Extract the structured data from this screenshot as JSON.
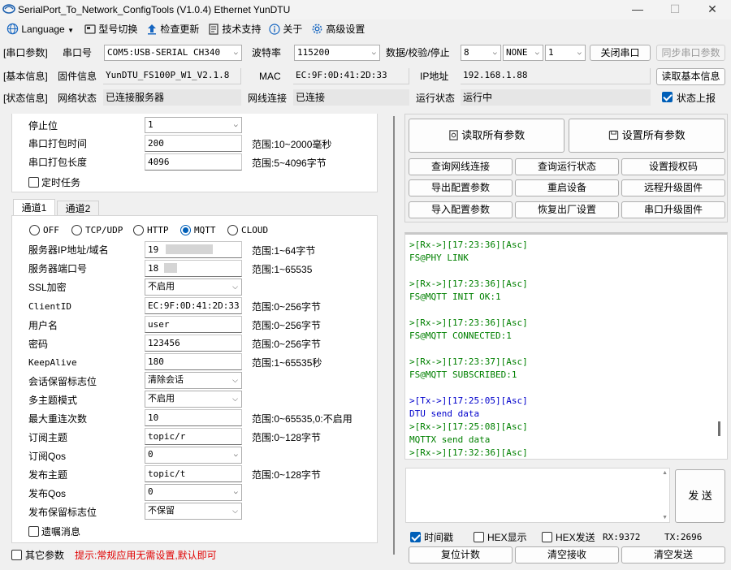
{
  "window": {
    "title": "SerialPort_To_Network_ConfigTools (V1.0.4) Ethernet YunDTU",
    "min": "—",
    "max": "☐",
    "close": "✕"
  },
  "menu": {
    "language": "Language",
    "model_switch": "型号切换",
    "check_update": "检查更新",
    "tech_support": "技术支持",
    "about": "关于",
    "advanced": "高级设置"
  },
  "serial_row": {
    "group": "[串口参数]",
    "port_label": "串口号",
    "port_value": "COM5:USB-SERIAL CH340",
    "baud_label": "波特率",
    "baud_value": "115200",
    "data_label": "数据/校验/停止",
    "data_bits": "8",
    "parity": "NONE",
    "stop_bits": "1",
    "close_port": "关闭串口",
    "sync_params": "同步串口参数"
  },
  "basic_row": {
    "group": "[基本信息]",
    "fw_label": "固件信息",
    "fw_value": "YunDTU_FS100P_W1_V2.1.8",
    "mac_label": "MAC",
    "mac_value": "EC:9F:0D:41:2D:33",
    "ip_label": "IP地址",
    "ip_value": "192.168.1.88",
    "read_basic": "读取基本信息"
  },
  "status_row": {
    "group": "[状态信息]",
    "net_label": "网络状态",
    "net_value": "已连接服务器",
    "link_label": "网线连接",
    "link_value": "已连接",
    "run_label": "运行状态",
    "run_value": "运行中",
    "report_label": "状态上报"
  },
  "serial_panel": {
    "stop_label": "停止位",
    "stop_value": "1",
    "pack_time_label": "串口打包时间",
    "pack_time_value": "200",
    "pack_time_range": "范围:10~2000毫秒",
    "pack_len_label": "串口打包长度",
    "pack_len_value": "4096",
    "pack_len_range": "范围:5~4096字节",
    "timer_task": "定时任务"
  },
  "tabs": [
    "通道1",
    "通道2"
  ],
  "protocols": [
    "OFF",
    "TCP/UDP",
    "HTTP",
    "MQTT",
    "CLOUD"
  ],
  "mqtt": {
    "server_label": "服务器IP地址/域名",
    "server_value": "19",
    "server_range": "范围:1~64字节",
    "port_label": "服务器端口号",
    "port_value": "18",
    "port_range": "范围:1~65535",
    "ssl_label": "SSL加密",
    "ssl_value": "不启用",
    "client_label": "ClientID",
    "client_value": "EC:9F:0D:41:2D:33",
    "client_range": "范围:0~256字节",
    "user_label": "用户名",
    "user_value": "user",
    "user_range": "范围:0~256字节",
    "pass_label": "密码",
    "pass_value": "123456",
    "pass_range": "范围:0~256字节",
    "keepalive_label": "KeepAlive",
    "keepalive_value": "180",
    "keepalive_range": "范围:1~65535秒",
    "clean_label": "会话保留标志位",
    "clean_value": "清除会话",
    "multi_label": "多主题模式",
    "multi_value": "不启用",
    "retry_label": "最大重连次数",
    "retry_value": "10",
    "retry_range": "范围:0~65535,0:不启用",
    "sub_topic_label": "订阅主题",
    "sub_topic_value": "topic/r",
    "sub_topic_range": "范围:0~128字节",
    "sub_qos_label": "订阅Qos",
    "sub_qos_value": "0",
    "pub_topic_label": "发布主题",
    "pub_topic_value": "topic/t",
    "pub_topic_range": "范围:0~128字节",
    "pub_qos_label": "发布Qos",
    "pub_qos_value": "0",
    "retain_label": "发布保留标志位",
    "retain_value": "不保留",
    "will_label": "遗嘱消息"
  },
  "bottom_left": {
    "other_params": "其它参数",
    "hint": "提示:常规应用无需设置,默认即可"
  },
  "right_buttons": {
    "read_all": "读取所有参数",
    "set_all": "设置所有参数",
    "query_link": "查询网线连接",
    "query_run": "查询运行状态",
    "set_auth": "设置授权码",
    "export_cfg": "导出配置参数",
    "restart": "重启设备",
    "remote_upgrade": "远程升级固件",
    "import_cfg": "导入配置参数",
    "factory_reset": "恢复出厂设置",
    "serial_upgrade": "串口升级固件"
  },
  "log": [
    {
      "cls": "rx",
      "text": ">[Rx->][17:23:36][Asc]"
    },
    {
      "cls": "rx",
      "text": "FS@PHY LINK"
    },
    {
      "cls": "",
      "text": ""
    },
    {
      "cls": "rx",
      "text": ">[Rx->][17:23:36][Asc]"
    },
    {
      "cls": "rx",
      "text": "FS@MQTT INIT OK:1"
    },
    {
      "cls": "",
      "text": ""
    },
    {
      "cls": "rx",
      "text": ">[Rx->][17:23:36][Asc]"
    },
    {
      "cls": "rx",
      "text": "FS@MQTT CONNECTED:1"
    },
    {
      "cls": "",
      "text": ""
    },
    {
      "cls": "rx",
      "text": ">[Rx->][17:23:37][Asc]"
    },
    {
      "cls": "rx",
      "text": "FS@MQTT SUBSCRIBED:1"
    },
    {
      "cls": "",
      "text": ""
    },
    {
      "cls": "tx",
      "text": ">[Tx->][17:25:05][Asc]"
    },
    {
      "cls": "tx",
      "text": "DTU send data"
    },
    {
      "cls": "rx",
      "text": ">[Rx->][17:25:08][Asc]"
    },
    {
      "cls": "rx",
      "text": "MQTTX send data"
    },
    {
      "cls": "rx",
      "text": ">[Rx->][17:32:36][Asc]"
    }
  ],
  "send": {
    "send_button": "发 送",
    "timestamp": "时间戳",
    "hex_display": "HEX显示",
    "hex_send": "HEX发送",
    "rx_count": "RX:9372",
    "tx_count": "TX:2696",
    "reset_count": "复位计数",
    "clear_recv": "清空接收",
    "clear_send": "清空发送"
  }
}
